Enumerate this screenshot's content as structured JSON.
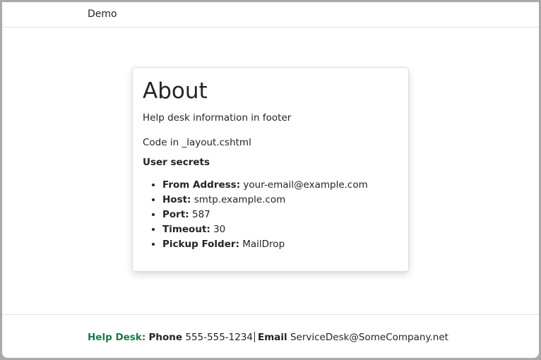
{
  "navbar": {
    "brand": "Demo"
  },
  "main": {
    "title": "About",
    "intro": "Help desk information in footer",
    "code_note": "Code in _layout.cshtml",
    "secrets_title": "User secrets",
    "secrets": [
      {
        "label": "From Address:",
        "value": "your-email@example.com"
      },
      {
        "label": "Host:",
        "value": "smtp.example.com"
      },
      {
        "label": "Port:",
        "value": "587"
      },
      {
        "label": "Timeout:",
        "value": "30"
      },
      {
        "label": "Pickup Folder:",
        "value": "MailDrop"
      }
    ]
  },
  "footer": {
    "help_desk_label": "Help Desk:",
    "phone_label": "Phone",
    "phone_value": "555-555-1234",
    "email_label": "Email",
    "email_value": "ServiceDesk@SomeCompany.net",
    "accent_color": "#1b7a4a"
  }
}
